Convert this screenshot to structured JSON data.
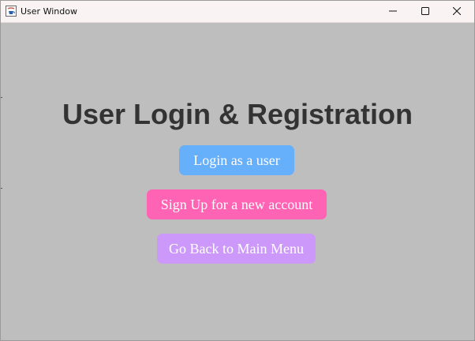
{
  "window": {
    "title": "User Window",
    "controls": {
      "minimize_icon": "minimize-icon",
      "maximize_icon": "maximize-icon",
      "close_icon": "close-icon"
    }
  },
  "main": {
    "heading": "User Login & Registration",
    "buttons": {
      "login": "Login as a user",
      "signup": "Sign Up for a new account",
      "back": "Go Back to Main Menu"
    }
  },
  "colors": {
    "background": "#bebebe",
    "heading": "#333333",
    "login_button": "#66b0fb",
    "signup_button": "#ff64b4",
    "back_button": "#cc99fb",
    "titlebar": "#f9f3f3"
  }
}
